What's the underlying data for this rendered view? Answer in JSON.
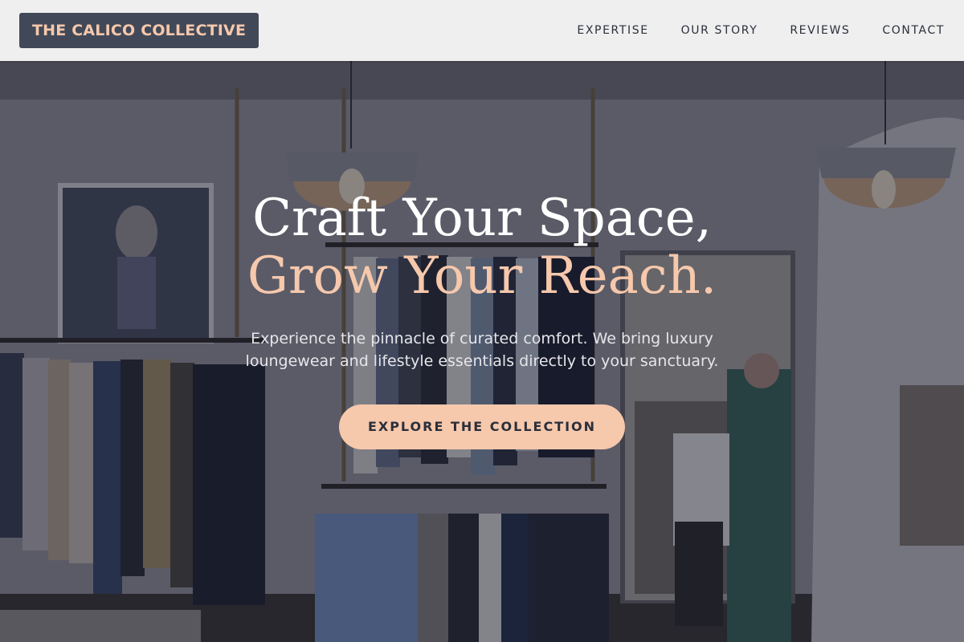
{
  "brand": {
    "name": "THE CALICO COLLECTIVE"
  },
  "nav": {
    "items": [
      {
        "label": "EXPERTISE"
      },
      {
        "label": "OUR STORY"
      },
      {
        "label": "REVIEWS"
      },
      {
        "label": "CONTACT"
      }
    ]
  },
  "hero": {
    "headline_line1": "Craft Your Space,",
    "headline_line2": "Grow Your Reach.",
    "subtext": "Experience the pinnacle of curated comfort. We bring luxury loungewear and lifestyle essentials directly to your sanctuary.",
    "cta_label": "EXPLORE THE COLLECTION"
  },
  "colors": {
    "accent": "#f6c8ac",
    "brand_bg": "#414958",
    "navbar_bg": "#efefef",
    "text_dark": "#2a2f3a"
  }
}
